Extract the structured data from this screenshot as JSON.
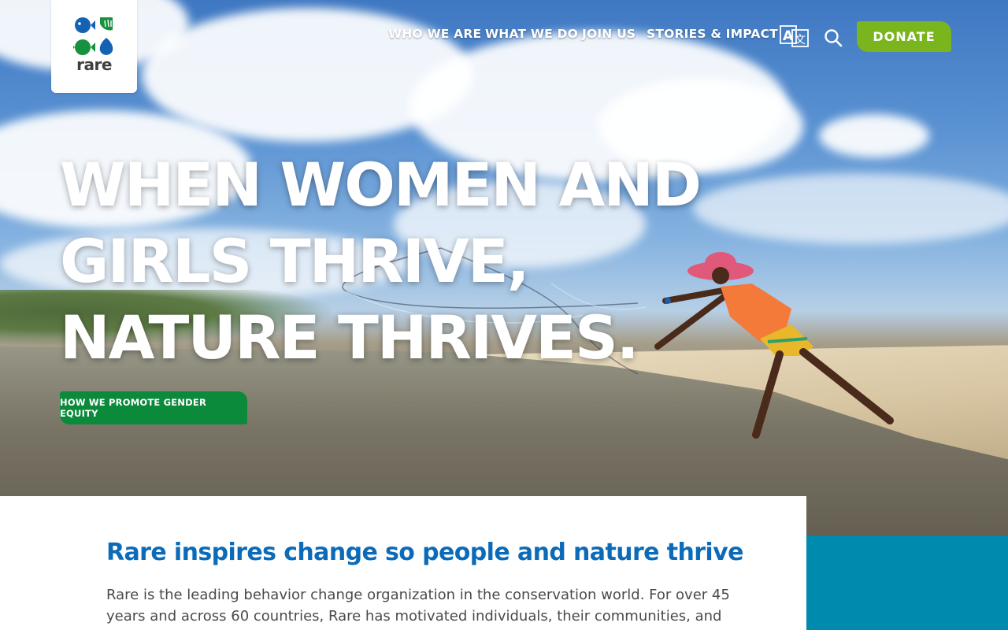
{
  "header": {
    "logo_text": "rare",
    "nav": [
      {
        "label": "WHO WE ARE"
      },
      {
        "label": "WHAT WE DO"
      },
      {
        "label": "JOIN US"
      },
      {
        "label": "STORIES & IMPACT"
      }
    ],
    "translate_icon": "translate-icon",
    "search_icon": "search-icon",
    "donate_label": "DONATE"
  },
  "hero": {
    "headline_lines": [
      "WHEN WOMEN AND",
      "GIRLS THRIVE,",
      "NATURE THRIVES."
    ],
    "cta_label": "HOW WE PROMOTE GENDER EQUITY"
  },
  "intro": {
    "heading": "Rare inspires change so people and nature thrive",
    "body": "Rare is the leading behavior change organization in the conservation world. For over 45 years and across 60 countries, Rare has motivated individuals, their communities, and their"
  },
  "colors": {
    "brand_blue": "#0c6bb8",
    "brand_green": "#0b8a3c",
    "donate_green": "#7ab51d",
    "teal": "#008aad"
  }
}
